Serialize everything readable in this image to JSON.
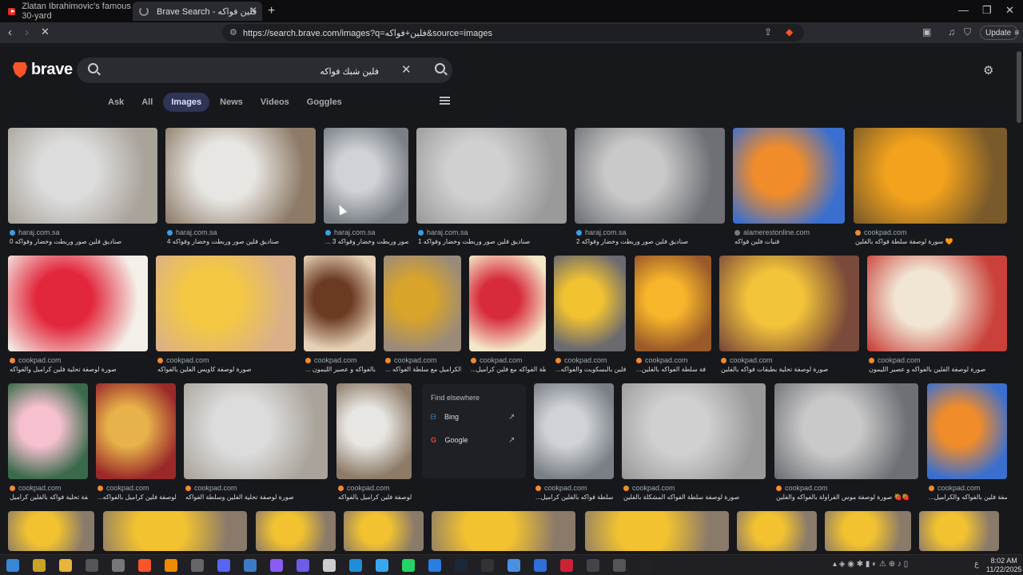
{
  "browser": {
    "tabs": [
      {
        "title": "Zlatan Ibrahimovic's famous 30-yard",
        "icon": "youtube-icon"
      },
      {
        "title": "Brave Search - فلين فواكه",
        "icon": "loading-spinner-icon"
      }
    ],
    "url": "https://search.brave.com/images?q=فلين+فواكه&source=images",
    "update_label": "Update"
  },
  "search": {
    "logo_text": "brave",
    "query": "فلين شبك فواكه",
    "tabs": [
      "Ask",
      "All",
      "Images",
      "News",
      "Videos",
      "Goggles"
    ],
    "active_tab": "Images"
  },
  "results": [
    {
      "source": "haraj.com.sa",
      "title": "صناديق فلين صور وربطت وخضار وفواكه 0"
    },
    {
      "source": "haraj.com.sa",
      "title": "صناديق فلين صور وربطت وخضار وفواكه 4"
    },
    {
      "source": "haraj.com.sa",
      "title": "... فلين صور وربطت وخضار وفواكه 3"
    },
    {
      "source": "haraj.com.sa",
      "title": "صناديق فلين صور وربطت وخضار وفواكه 1"
    },
    {
      "source": "haraj.com.sa",
      "title": "صناديق فلين صور وربطت وخضار وفواكه 2"
    },
    {
      "source": "alamerestonline.com",
      "title": "فنيات فلين فواكه"
    },
    {
      "source": "cookpad.com",
      "title": "سورة لوصفة سلطة فواكه بالفلين 🧡"
    },
    {
      "source": "cookpad.com",
      "title": "صورة لوصفة تحلية فلين كراميل والفواكه"
    },
    {
      "source": "cookpad.com",
      "title": "صورة لوصفة كاويس الفلين بالفواكه"
    },
    {
      "source": "cookpad.com",
      "title": "... فلين بالفواكه و عصير الليمون"
    },
    {
      "source": "cookpad.com",
      "title": "... فلين الكراميل مع سلطة الفواكه"
    },
    {
      "source": "cookpad.com",
      "title": "...بة سلطة الفواكه مع فلين كراميل"
    },
    {
      "source": "cookpad.com",
      "title": "...وصفة فلين بالبسكويت والفواكه"
    },
    {
      "source": "cookpad.com",
      "title": "...فة سلطة الفواكه بالفلين"
    },
    {
      "source": "cookpad.com",
      "title": "صورة لوصفة تحلية بطبقات فواكه بالفلين"
    },
    {
      "source": "cookpad.com",
      "title": "صورة لوصفة الفلين بالفواكه و عصير الليمون"
    },
    {
      "source": "cookpad.com",
      "title": "صورة لوصفة تحلية فواكه بالفلين كراميل"
    },
    {
      "source": "cookpad.com",
      "title": "...ورة لوصفة فلين كراميل بالفواكه"
    },
    {
      "source": "cookpad.com",
      "title": "صورة لوصفة تحلية الفلين وسلطة الفواكه"
    },
    {
      "source": "cookpad.com",
      "title": "صورة لوصفة فلين كراميل بالفواكه"
    },
    {
      "source": "cookpad.com",
      "title": "...ة لوصفة سلطة فواكه بالفلين كراميل"
    },
    {
      "source": "cookpad.com",
      "title": "صورة لوصفة سلطة الفواكه المشكلة بالفلين"
    },
    {
      "source": "cookpad.com",
      "title": "صورة لوصفة موس الفراولة بالفواكه والفلين 🍓🍓"
    },
    {
      "source": "cookpad.com",
      "title": "...صورة لوصفة فلين بالفواكه والكراميل"
    }
  ],
  "find_elsewhere": {
    "title": "Find elsewhere",
    "items": [
      "Bing",
      "Google"
    ]
  },
  "taskbar": {
    "time": "8:02 AM",
    "date": "11/22/2025",
    "lang": "ع"
  }
}
